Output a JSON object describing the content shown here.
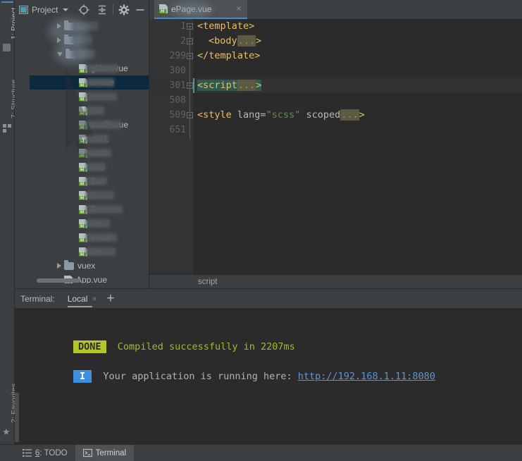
{
  "window": {
    "accent_blue": "#4a88c7",
    "bg": "#3c3f41",
    "editor_bg": "#2b2b2b"
  },
  "left_strip": {
    "items": [
      {
        "label": "1: Project",
        "icon": "project-icon",
        "selected": true
      },
      {
        "label": "7: Structure",
        "icon": "structure-icon",
        "selected": false
      },
      {
        "label": "2: Favorites",
        "icon": "star-icon",
        "selected": false
      }
    ]
  },
  "project_panel": {
    "title": "Project",
    "toolbar": [
      {
        "name": "project-view-dropdown",
        "label": "Project",
        "icon": "project-window-icon"
      },
      {
        "name": "locate-file-button",
        "label": "",
        "icon": "target-icon"
      },
      {
        "name": "collapse-all-button",
        "label": "",
        "icon": "collapse-all-icon"
      },
      {
        "name": "settings-button",
        "label": "",
        "icon": "gear-icon"
      },
      {
        "name": "hide-button",
        "label": "",
        "icon": "minimize-icon"
      }
    ],
    "tree": [
      {
        "indent": 1,
        "arrow": "closed",
        "icon": "folder-icon",
        "text": "ter",
        "blurred": true,
        "selected": false
      },
      {
        "indent": 1,
        "arrow": "closed",
        "icon": "folder-icon",
        "text": "u",
        "blurred": true,
        "selected": false
      },
      {
        "indent": 1,
        "arrow": "open",
        "icon": "folder-icon",
        "text": "vi",
        "blurred": true,
        "selected": false
      },
      {
        "indent": 2,
        "arrow": "none",
        "icon": "vue-file-icon",
        "text": "gMan.vue",
        "blurred": true,
        "selected": false
      },
      {
        "indent": 2,
        "arrow": "none",
        "icon": "vue-file-icon",
        "text": "n       .vue",
        "blurred": true,
        "selected": true
      },
      {
        "indent": 2,
        "arrow": "none",
        "icon": "vue-file-icon",
        "text": "",
        "blurred": true,
        "selected": false
      },
      {
        "indent": 2,
        "arrow": "none",
        "icon": "vue-file-icon",
        "text": "i.v",
        "blurred": true,
        "selected": false
      },
      {
        "indent": 2,
        "arrow": "none",
        "icon": "vue-file-icon",
        "text": "oveP   .vue",
        "blurred": true,
        "selected": false
      },
      {
        "indent": 2,
        "arrow": "none",
        "icon": "vue-file-icon",
        "text": "ovel.",
        "blurred": true,
        "selected": false
      },
      {
        "indent": 2,
        "arrow": "none",
        "icon": "vue-file-icon",
        "text": "arch",
        "blurred": true,
        "selected": false
      },
      {
        "indent": 2,
        "arrow": "none",
        "icon": "vue-file-icon",
        "text": "t.vu",
        "blurred": true,
        "selected": false
      },
      {
        "indent": 2,
        "arrow": "none",
        "icon": "vue-file-icon",
        "text": "2.v",
        "blurred": true,
        "selected": false
      },
      {
        "indent": 2,
        "arrow": "none",
        "icon": "vue-file-icon",
        "text": "t",
        "blurred": true,
        "selected": false
      },
      {
        "indent": 2,
        "arrow": "none",
        "icon": "vue-file-icon",
        "text": "T",
        "blurred": true,
        "selected": false
      },
      {
        "indent": 2,
        "arrow": "none",
        "icon": "vue-file-icon",
        "text": "ve",
        "blurred": true,
        "selected": false
      },
      {
        "indent": 2,
        "arrow": "none",
        "icon": "vue-file-icon",
        "text": "v      vue",
        "blurred": true,
        "selected": false
      },
      {
        "indent": 2,
        "arrow": "none",
        "icon": "vue-file-icon",
        "text": "on",
        "blurred": true,
        "selected": false
      },
      {
        "indent": 1,
        "arrow": "closed",
        "icon": "folder-icon",
        "text": "vuex",
        "blurred": false,
        "selected": false
      },
      {
        "indent": 1,
        "arrow": "none",
        "icon": "vue-file-icon",
        "text": "App.vue",
        "blurred": false,
        "selected": false
      }
    ]
  },
  "editor": {
    "tab": {
      "label": "ePage.vue",
      "icon": "vue-file-icon",
      "close": "×",
      "modified": false
    },
    "line_numbers": [
      "1",
      "2",
      "299",
      "300",
      "301",
      "508",
      "509",
      "651"
    ],
    "lines": [
      {
        "num": "1",
        "fold": "minus",
        "indent": 0,
        "tokens": [
          {
            "t": "<template>",
            "c": "tag"
          }
        ]
      },
      {
        "num": "2",
        "fold": "plus",
        "indent": 2,
        "tokens": [
          {
            "t": "<body",
            "c": "tag"
          },
          {
            "t": "...",
            "c": "ellipsis"
          },
          {
            "t": ">",
            "c": "tag"
          }
        ]
      },
      {
        "num": "299",
        "fold": "minus",
        "indent": 0,
        "tokens": [
          {
            "t": "</template>",
            "c": "tag"
          }
        ]
      },
      {
        "num": "300",
        "fold": "",
        "indent": 0,
        "tokens": []
      },
      {
        "num": "301",
        "fold": "plus",
        "indent": 0,
        "selected": true,
        "tokens": [
          {
            "t": "<script",
            "c": "tag"
          },
          {
            "t": "...",
            "c": "ellipsis"
          },
          {
            "t": ">",
            "c": "tag"
          }
        ]
      },
      {
        "num": "508",
        "fold": "",
        "indent": 0,
        "tokens": []
      },
      {
        "num": "509",
        "fold": "plus",
        "indent": 0,
        "tokens": [
          {
            "t": "<style",
            "c": "tag"
          },
          {
            "t": " lang=",
            "c": "attr"
          },
          {
            "t": "\"scss\"",
            "c": "str"
          },
          {
            "t": " scoped",
            "c": "attr"
          },
          {
            "t": "...",
            "c": "ellipsis"
          },
          {
            "t": ">",
            "c": "tag"
          }
        ]
      },
      {
        "num": "651",
        "fold": "",
        "indent": 0,
        "tokens": []
      }
    ],
    "breadcrumb": "script"
  },
  "terminal": {
    "label": "Terminal:",
    "tabs": [
      {
        "name": "Local",
        "close": "×",
        "active": true
      }
    ],
    "add_button": "+",
    "output": [
      {
        "badge": "DONE",
        "badge_style": "done",
        "text": "  Compiled successfully in 2207ms"
      },
      {
        "badge": "I",
        "badge_style": "info",
        "text": "  Your application is running here: ",
        "link": "http://192.168.1.11:8080"
      }
    ]
  },
  "statusbar": {
    "tabs": [
      {
        "label_prefix": "6",
        "label": ": TODO",
        "icon": "todo-list-icon",
        "active": false
      },
      {
        "label_prefix": "",
        "label": "Terminal",
        "icon": "terminal-icon",
        "active": true
      }
    ]
  }
}
